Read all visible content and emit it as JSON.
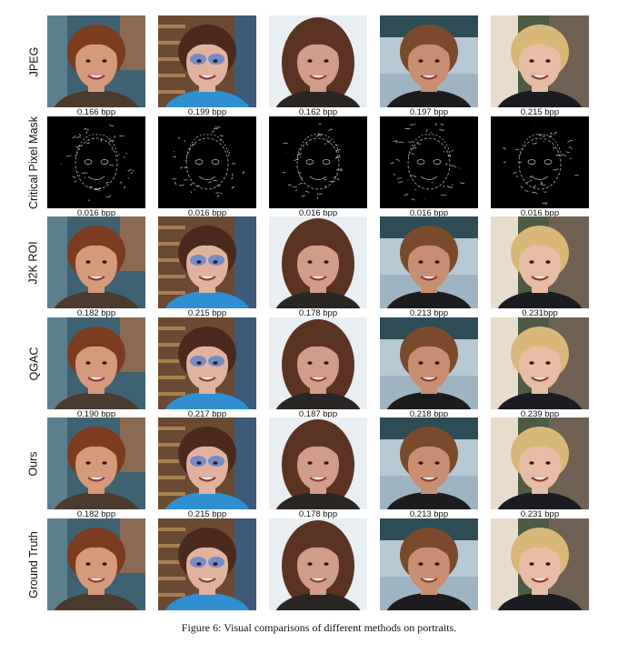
{
  "figure": {
    "caption": "Figure 6: Visual comparisons of different methods on portraits.",
    "columns": [
      "man-red-hair",
      "girl-face-paint",
      "woman-long-hair",
      "woman-short-hair",
      "woman-blonde"
    ],
    "rows": [
      {
        "label": "JPEG",
        "kind": "photo",
        "bpp": [
          "0.166 bpp",
          "0.199 bpp",
          "0.162 bpp",
          "0.197 bpp",
          "0.215 bpp"
        ]
      },
      {
        "label": "Critical Pixel Mask",
        "kind": "mask",
        "bpp": [
          "0.016 bpp",
          "0.016 bpp",
          "0.016 bpp",
          "0.016 bpp",
          "0.016 bpp"
        ]
      },
      {
        "label": "J2K ROI",
        "kind": "photo",
        "bpp": [
          "0.182 bpp",
          "0.215 bpp",
          "0.178 bpp",
          "0.213 bpp",
          "0.231bpp"
        ]
      },
      {
        "label": "QGAC",
        "kind": "photo",
        "bpp": [
          "0.190 bpp",
          "0.217 bpp",
          "0.187 bpp",
          "0.218 bpp",
          "0.239 bpp"
        ]
      },
      {
        "label": "Ours",
        "kind": "photo",
        "bpp": [
          "0.182 bpp",
          "0.215 bpp",
          "0.178 bpp",
          "0.213 bpp",
          "0.231 bpp"
        ]
      },
      {
        "label": "Ground Truth",
        "kind": "photo",
        "bpp": []
      }
    ]
  },
  "palette": {
    "skin": [
      "#d59a7c",
      "#e1b39e",
      "#cf9d88",
      "#c88e72",
      "#e6bca4"
    ],
    "hair": [
      "#7b3c1f",
      "#4a2a1c",
      "#5a3322",
      "#7a4a2c",
      "#d8b878"
    ],
    "bg": [
      "#3f6272",
      "#6b4a34",
      "#e9eef2",
      "#9fb4c2",
      "#4f5a44"
    ],
    "cloth": [
      "#4b3a2e",
      "#2f8fd0",
      "#2a2624",
      "#1c1c1e",
      "#1b1b22"
    ],
    "mask_bg": "#000000",
    "mask_stroke": "#e6e6e6"
  }
}
